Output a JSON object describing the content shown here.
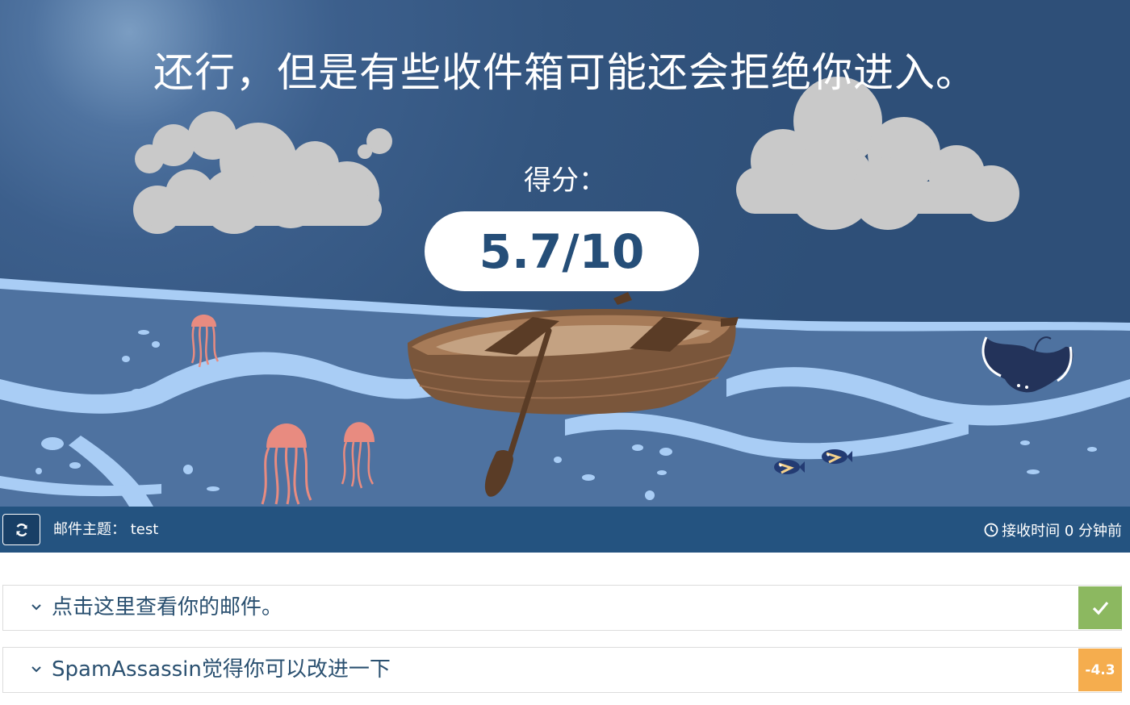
{
  "hero": {
    "headline": "还行，但是有些收件箱可能还会拒绝你进入。",
    "score_label": "得分：",
    "score_value": "5.7/10"
  },
  "info_bar": {
    "refresh_icon": "refresh-icon",
    "subject_label": "邮件主题：",
    "subject_value": "test",
    "clock_icon": "clock-icon",
    "received_text": "接收时间 0 分钟前"
  },
  "panels": [
    {
      "label": "点击这里查看你的邮件。",
      "badge_icon": "check-icon",
      "badge_color": "#8cb860"
    },
    {
      "label": "SpamAssassin觉得你可以改进一下",
      "badge_text": "-4.3",
      "badge_color": "#f5ad4e"
    }
  ]
}
